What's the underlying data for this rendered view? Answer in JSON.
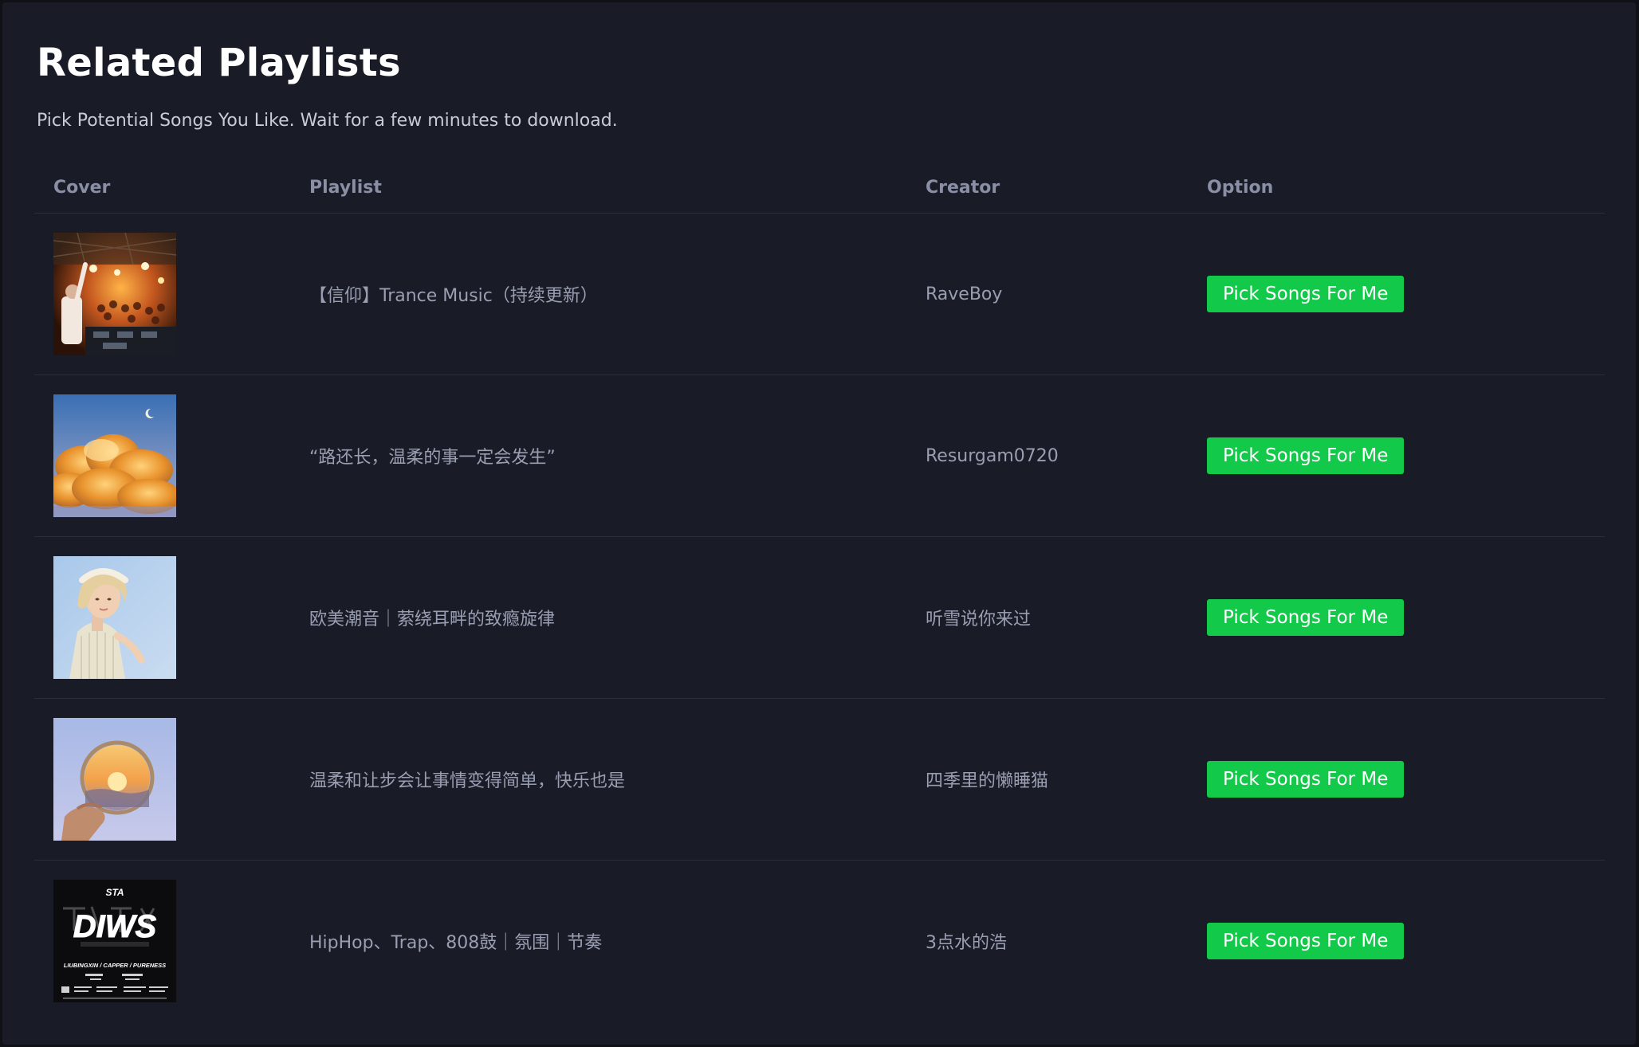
{
  "header": {
    "title": "Related Playlists",
    "subtitle": "Pick Potential Songs You Like. Wait for a few minutes to download."
  },
  "table": {
    "columns": [
      "Cover",
      "Playlist",
      "Creator",
      "Option"
    ],
    "rows": [
      {
        "playlist": "【信仰】Trance Music（持续更新）",
        "creator": "RaveBoy",
        "option": "Pick Songs For Me"
      },
      {
        "playlist": "“路还长，温柔的事一定会发生”",
        "creator": "Resurgam0720",
        "option": "Pick Songs For Me"
      },
      {
        "playlist": "欧美潮音｜萦绕耳畔的致瘾旋律",
        "creator": "听雪说你来过",
        "option": "Pick Songs For Me"
      },
      {
        "playlist": "温柔和让步会让事情变得简单，快乐也是",
        "creator": "四季里的懒睡猫",
        "option": "Pick Songs For Me"
      },
      {
        "playlist": "HipHop、Trap、808鼓｜氛围｜节奏",
        "creator": "3点水的浩",
        "option": "Pick Songs For Me"
      }
    ]
  },
  "covers": {
    "cover5_logo": "DIWS",
    "cover5_top": "STA",
    "cover5_credits": "LIUBINGXIN / CAPPER / PURENESS"
  },
  "colors": {
    "background": "#191b26",
    "accent": "#13c94a",
    "header_text": "#8a8fa6",
    "cell_text": "#9a9eb2"
  }
}
